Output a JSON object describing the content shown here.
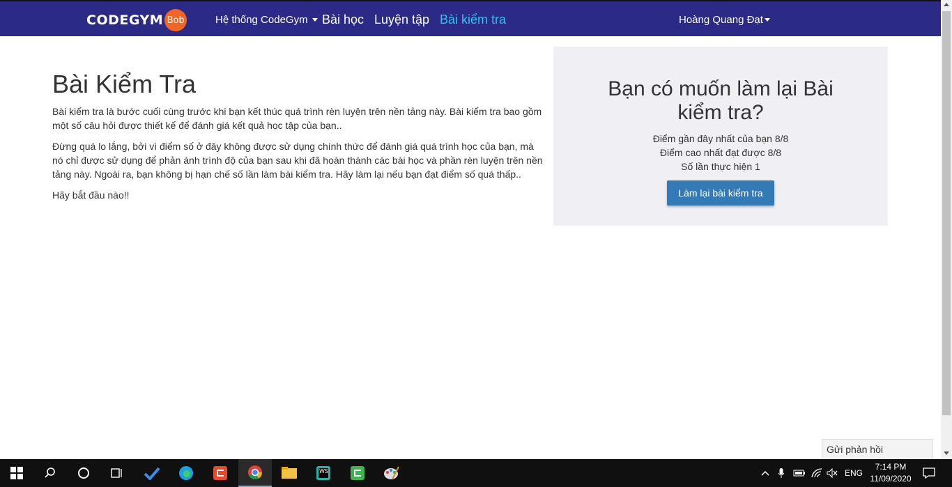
{
  "navbar": {
    "logo_text": "CODEGYM",
    "logo_badge": "Bob",
    "menu_system": "Hệ thống CodeGym",
    "menu_lessons": "Bài học",
    "menu_practice": "Luyện tập",
    "menu_tests": "Bài kiểm tra",
    "user_name": "Hoàng Quang Đạt"
  },
  "main": {
    "title": "Bài Kiểm Tra",
    "paragraph_1": "Bài kiểm tra là bước cuối cùng trước khi bạn kết thúc quá trình rèn luyện trên nền tảng này. Bài kiểm tra bao gồm một số câu hỏi được thiết kế để đánh giá kết quả học tập của bạn..",
    "paragraph_2": "Đừng quá lo lắng, bởi vì điểm số ở đây không được sử dụng chính thức để đánh giá quá trình học của bạn, mà nó chỉ được sử dụng để phản ánh trình độ của bạn sau khi đã hoàn thành các bài học và phần rèn luyện trên nền tảng này. Ngoài ra, bạn không bị hạn chế số lần làm bài kiểm tra. Hãy làm lại nếu bạn đạt điểm số quá thấp..",
    "paragraph_3": "Hãy bắt đầu nào!!"
  },
  "panel": {
    "title": "Bạn có muốn làm lại Bài kiểm tra?",
    "latest_score": "Điểm gần đây nhất của bạn  8/8",
    "best_score": "Điểm cao nhất đạt được  8/8",
    "attempts": "Số lần thực hiện  1",
    "retry_button": "Làm lại bài kiểm tra"
  },
  "feedback_label": "Gửi phản hồi",
  "taskbar": {
    "language": "ENG",
    "time": "7:14 PM",
    "date": "11/09/2020"
  },
  "colors": {
    "navbar_bg": "#2b2a86",
    "nav_active": "#35c2f0",
    "button_primary": "#337ab7",
    "panel_bg": "#efeff4",
    "logo_badge": "#f26522"
  }
}
